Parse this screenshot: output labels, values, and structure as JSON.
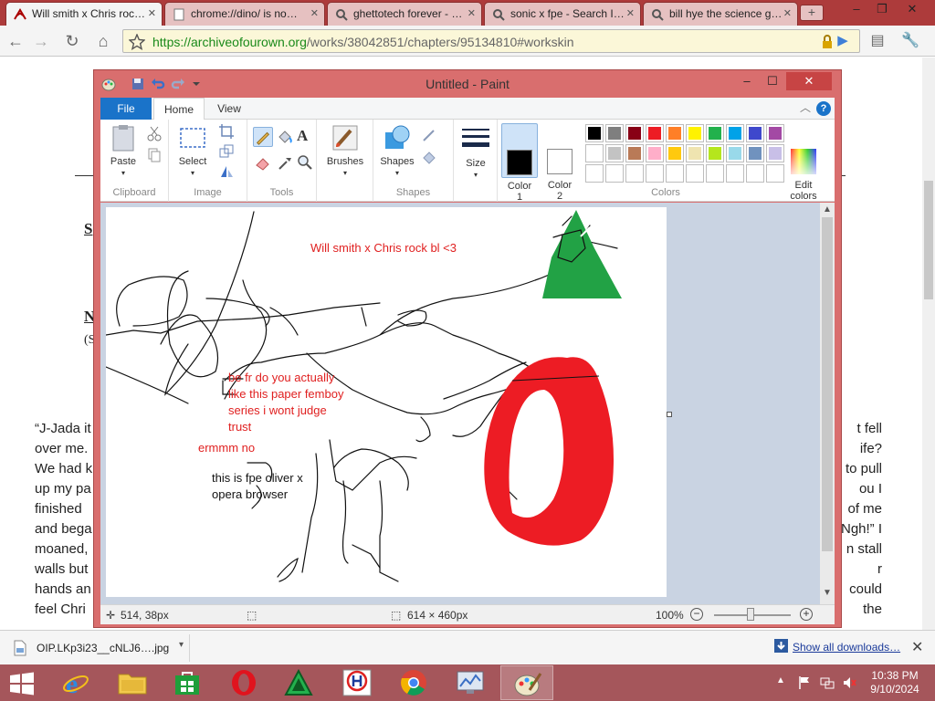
{
  "browser": {
    "tabs": [
      {
        "title": "Will smith x Chris roc…",
        "active": true
      },
      {
        "title": "chrome://dino/ is no…",
        "active": false
      },
      {
        "title": "ghettotech forever - …",
        "active": false
      },
      {
        "title": "sonic x fpe - Search I…",
        "active": false
      },
      {
        "title": "bill hye the science g…",
        "active": false
      }
    ],
    "url_host": "https://archiveofourown.org",
    "url_path": "/works/38042851/chapters/95134810#workskin"
  },
  "page": {
    "fragments": [
      "S",
      "N",
      "(S"
    ],
    "story_left": [
      "“J-Jada it",
      "over me.",
      "We had k",
      "up my pa",
      "finished",
      "and bega",
      "moaned,",
      "walls but",
      "hands an",
      "feel Chri"
    ],
    "story_right": [
      "t fell",
      "ife?",
      "to pull",
      "ou I",
      "of me",
      "Ngh!” I",
      "n stall",
      "r",
      "could",
      "the"
    ]
  },
  "paint": {
    "window_title": "Untitled - Paint",
    "ribbon_tabs": {
      "file": "File",
      "home": "Home",
      "view": "View"
    },
    "help": "?",
    "groups": {
      "clipboard": {
        "label": "Clipboard",
        "paste": "Paste"
      },
      "image": {
        "label": "Image",
        "select": "Select"
      },
      "tools": {
        "label": "Tools"
      },
      "brushes": {
        "label": "Brushes"
      },
      "shapes": {
        "label": "Shapes",
        "shapes_btn": "Shapes"
      },
      "size": {
        "label": "Size"
      },
      "colors": {
        "label": "Colors",
        "color1": "Color\n1",
        "color2": "Color\n2",
        "edit": "Edit\ncolors"
      }
    },
    "colors": {
      "color1": "#000000",
      "color2": "#ffffff",
      "palette_row1": [
        "#000000",
        "#7f7f7f",
        "#880015",
        "#ed1c24",
        "#ff7f27",
        "#fff200",
        "#22b14c",
        "#00a2e8",
        "#3f48cc",
        "#a349a4"
      ],
      "palette_row2": [
        "#ffffff",
        "#c3c3c3",
        "#b97a57",
        "#ffaec9",
        "#ffc90e",
        "#efe4b0",
        "#b5e61d",
        "#99d9ea",
        "#7092be",
        "#c8bfe7"
      ]
    },
    "canvas_text": {
      "title": "Will smith x Chris rock bl <3",
      "question_1": "be fr do you actually",
      "question_2": "like this paper femboy",
      "question_3": "series i wont judge",
      "question_4": "trust",
      "ermm": "ermmm no",
      "caption_1": "this is fpe oliver x",
      "caption_2": "opera browser"
    },
    "text_colors": {
      "red": "#e02020",
      "black": "#111111"
    },
    "shape_colors": {
      "red": "#ed1c24",
      "green": "#22a245"
    },
    "status": {
      "cursor": "514, 38px",
      "selection": "",
      "size": "614 × 460px",
      "zoom": "100%"
    }
  },
  "downloads": {
    "filename": "OIP.LKp3i23__cNLJ6….jpg",
    "show_all": "Show all downloads…",
    "close": "✕"
  },
  "taskbar": {
    "time": "10:38 PM",
    "date": "9/10/2024"
  }
}
